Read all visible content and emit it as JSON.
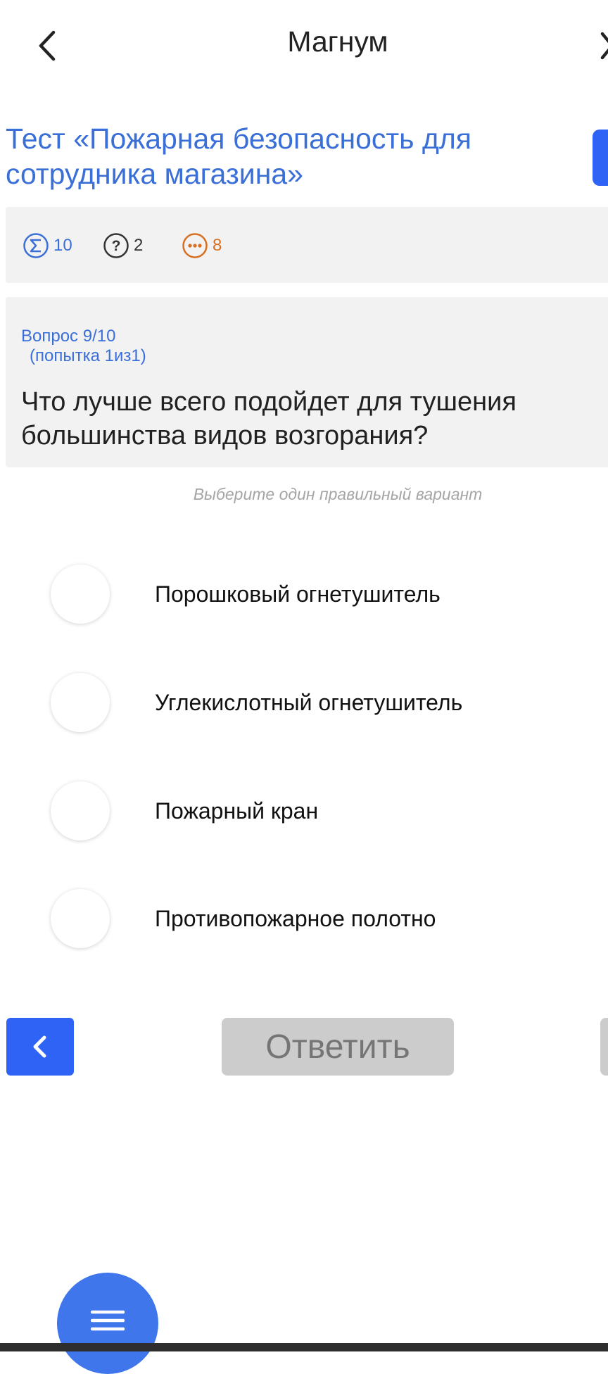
{
  "header": {
    "title": "Магнум"
  },
  "test": {
    "title": " Тест «Пожарная безопасность для сотрудника магазина»"
  },
  "stats": {
    "total": "10",
    "unanswered": "2",
    "remaining": "8"
  },
  "question": {
    "number": "Вопрос 9/10",
    "attempt": "(попытка 1из1)",
    "text": "Что лучше всего подойдет для тушения большинства видов возгорания?",
    "hint": "Выберите один правильный вариант"
  },
  "options": [
    {
      "label": "Порошковый огнетушитель",
      "selected": false
    },
    {
      "label": "Углекислотный огнетушитель",
      "selected": false
    },
    {
      "label": "Пожарный кран",
      "selected": false
    },
    {
      "label": "Противопожарное полотно",
      "selected": false
    }
  ],
  "actions": {
    "answer_label": "Ответить"
  },
  "icons": {
    "back": "chevron-left-icon",
    "close": "close-icon",
    "total": "sigma-icon",
    "unanswered": "question-icon",
    "remaining": "ellipsis-icon",
    "prev": "chevron-left-icon",
    "menu": "hamburger-icon"
  },
  "colors": {
    "accent": "#2f63f5",
    "title_blue": "#3a6fd8",
    "remaining_orange": "#d86f1f",
    "disabled_button": "#cccccc"
  }
}
